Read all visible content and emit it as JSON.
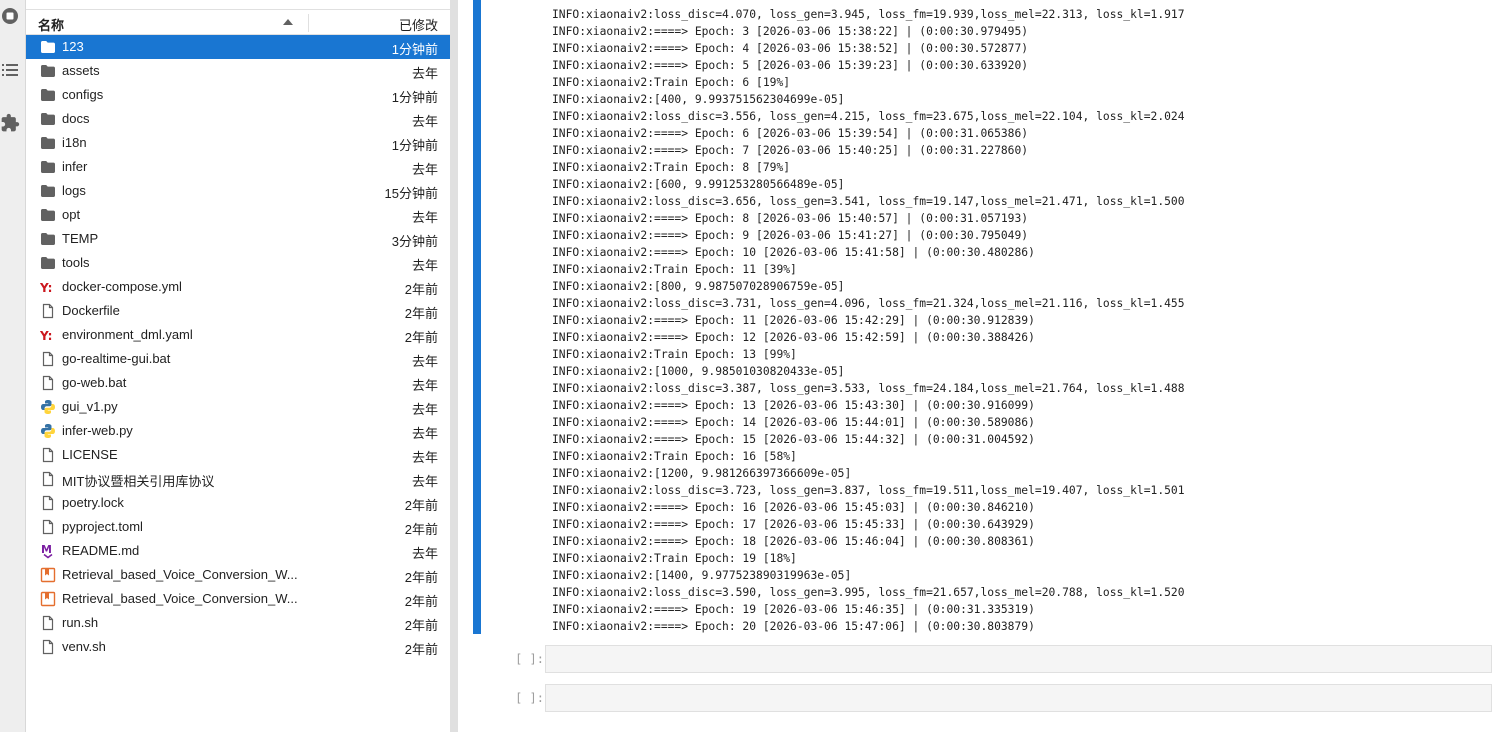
{
  "file_browser": {
    "header": {
      "name_label": "名称",
      "modified_label": "已修改"
    },
    "files": [
      {
        "name": "123",
        "modified": "1分钟前",
        "type": "folder",
        "selected": true
      },
      {
        "name": "assets",
        "modified": "去年",
        "type": "folder"
      },
      {
        "name": "configs",
        "modified": "1分钟前",
        "type": "folder"
      },
      {
        "name": "docs",
        "modified": "去年",
        "type": "folder"
      },
      {
        "name": "i18n",
        "modified": "1分钟前",
        "type": "folder"
      },
      {
        "name": "infer",
        "modified": "去年",
        "type": "folder"
      },
      {
        "name": "logs",
        "modified": "15分钟前",
        "type": "folder"
      },
      {
        "name": "opt",
        "modified": "去年",
        "type": "folder"
      },
      {
        "name": "TEMP",
        "modified": "3分钟前",
        "type": "folder"
      },
      {
        "name": "tools",
        "modified": "去年",
        "type": "folder"
      },
      {
        "name": "docker-compose.yml",
        "modified": "2年前",
        "type": "yaml"
      },
      {
        "name": "Dockerfile",
        "modified": "2年前",
        "type": "file"
      },
      {
        "name": "environment_dml.yaml",
        "modified": "2年前",
        "type": "yaml"
      },
      {
        "name": "go-realtime-gui.bat",
        "modified": "去年",
        "type": "file"
      },
      {
        "name": "go-web.bat",
        "modified": "去年",
        "type": "file"
      },
      {
        "name": "gui_v1.py",
        "modified": "去年",
        "type": "python"
      },
      {
        "name": "infer-web.py",
        "modified": "去年",
        "type": "python"
      },
      {
        "name": "LICENSE",
        "modified": "去年",
        "type": "file"
      },
      {
        "name": "MIT协议暨相关引用库协议",
        "modified": "去年",
        "type": "file"
      },
      {
        "name": "poetry.lock",
        "modified": "2年前",
        "type": "file"
      },
      {
        "name": "pyproject.toml",
        "modified": "2年前",
        "type": "file"
      },
      {
        "name": "README.md",
        "modified": "去年",
        "type": "markdown"
      },
      {
        "name": "Retrieval_based_Voice_Conversion_W...",
        "modified": "2年前",
        "type": "notebook"
      },
      {
        "name": "Retrieval_based_Voice_Conversion_W...",
        "modified": "2年前",
        "type": "notebook"
      },
      {
        "name": "run.sh",
        "modified": "2年前",
        "type": "file"
      },
      {
        "name": "venv.sh",
        "modified": "2年前",
        "type": "file"
      }
    ]
  },
  "notebook": {
    "output_lines": [
      "INFO:xiaonaiv2:loss_disc=4.070, loss_gen=3.945, loss_fm=19.939,loss_mel=22.313, loss_kl=1.917",
      "INFO:xiaonaiv2:====> Epoch: 3 [2026-03-06 15:38:22] | (0:00:30.979495)",
      "INFO:xiaonaiv2:====> Epoch: 4 [2026-03-06 15:38:52] | (0:00:30.572877)",
      "INFO:xiaonaiv2:====> Epoch: 5 [2026-03-06 15:39:23] | (0:00:30.633920)",
      "INFO:xiaonaiv2:Train Epoch: 6 [19%]",
      "INFO:xiaonaiv2:[400, 9.993751562304699e-05]",
      "INFO:xiaonaiv2:loss_disc=3.556, loss_gen=4.215, loss_fm=23.675,loss_mel=22.104, loss_kl=2.024",
      "INFO:xiaonaiv2:====> Epoch: 6 [2026-03-06 15:39:54] | (0:00:31.065386)",
      "INFO:xiaonaiv2:====> Epoch: 7 [2026-03-06 15:40:25] | (0:00:31.227860)",
      "INFO:xiaonaiv2:Train Epoch: 8 [79%]",
      "INFO:xiaonaiv2:[600, 9.991253280566489e-05]",
      "INFO:xiaonaiv2:loss_disc=3.656, loss_gen=3.541, loss_fm=19.147,loss_mel=21.471, loss_kl=1.500",
      "INFO:xiaonaiv2:====> Epoch: 8 [2026-03-06 15:40:57] | (0:00:31.057193)",
      "INFO:xiaonaiv2:====> Epoch: 9 [2026-03-06 15:41:27] | (0:00:30.795049)",
      "INFO:xiaonaiv2:====> Epoch: 10 [2026-03-06 15:41:58] | (0:00:30.480286)",
      "INFO:xiaonaiv2:Train Epoch: 11 [39%]",
      "INFO:xiaonaiv2:[800, 9.987507028906759e-05]",
      "INFO:xiaonaiv2:loss_disc=3.731, loss_gen=4.096, loss_fm=21.324,loss_mel=21.116, loss_kl=1.455",
      "INFO:xiaonaiv2:====> Epoch: 11 [2026-03-06 15:42:29] | (0:00:30.912839)",
      "INFO:xiaonaiv2:====> Epoch: 12 [2026-03-06 15:42:59] | (0:00:30.388426)",
      "INFO:xiaonaiv2:Train Epoch: 13 [99%]",
      "INFO:xiaonaiv2:[1000, 9.98501030820433e-05]",
      "INFO:xiaonaiv2:loss_disc=3.387, loss_gen=3.533, loss_fm=24.184,loss_mel=21.764, loss_kl=1.488",
      "INFO:xiaonaiv2:====> Epoch: 13 [2026-03-06 15:43:30] | (0:00:30.916099)",
      "INFO:xiaonaiv2:====> Epoch: 14 [2026-03-06 15:44:01] | (0:00:30.589086)",
      "INFO:xiaonaiv2:====> Epoch: 15 [2026-03-06 15:44:32] | (0:00:31.004592)",
      "INFO:xiaonaiv2:Train Epoch: 16 [58%]",
      "INFO:xiaonaiv2:[1200, 9.981266397366609e-05]",
      "INFO:xiaonaiv2:loss_disc=3.723, loss_gen=3.837, loss_fm=19.511,loss_mel=19.407, loss_kl=1.501",
      "INFO:xiaonaiv2:====> Epoch: 16 [2026-03-06 15:45:03] | (0:00:30.846210)",
      "INFO:xiaonaiv2:====> Epoch: 17 [2026-03-06 15:45:33] | (0:00:30.643929)",
      "INFO:xiaonaiv2:====> Epoch: 18 [2026-03-06 15:46:04] | (0:00:30.808361)",
      "INFO:xiaonaiv2:Train Epoch: 19 [18%]",
      "INFO:xiaonaiv2:[1400, 9.977523890319963e-05]",
      "INFO:xiaonaiv2:loss_disc=3.590, loss_gen=3.995, loss_fm=21.657,loss_mel=20.788, loss_kl=1.520",
      "INFO:xiaonaiv2:====> Epoch: 19 [2026-03-06 15:46:35] | (0:00:31.335319)",
      "INFO:xiaonaiv2:====> Epoch: 20 [2026-03-06 15:47:06] | (0:00:30.803879)"
    ],
    "empty_cells": [
      {
        "prompt": "[ ]:"
      },
      {
        "prompt": "[ ]:"
      }
    ]
  },
  "activity_bar": {
    "icons": [
      "running-stop-icon",
      "list-icon",
      "extension-puzzle-icon"
    ]
  },
  "colors": {
    "accent": "#1976d2",
    "folder": "#616161",
    "yaml": "#cb171e",
    "python_blue": "#3572a5",
    "python_yellow": "#ffd43b",
    "markdown": "#7b1fa2",
    "notebook": "#e46e2e"
  }
}
